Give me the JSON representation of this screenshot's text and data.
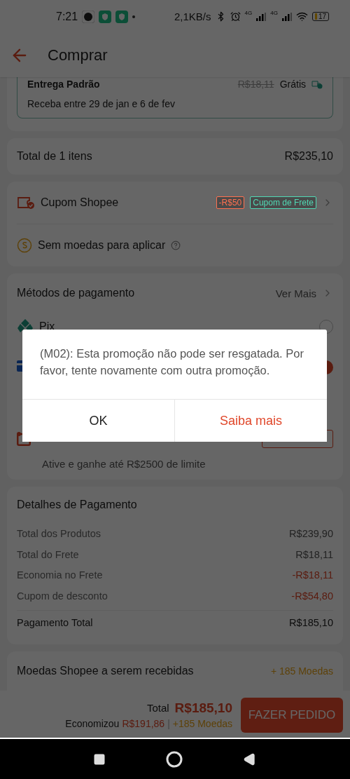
{
  "status_bar": {
    "time": "7:21",
    "speed": "2,1KB/s",
    "network_labels": [
      "4G",
      "4G"
    ],
    "battery": "17"
  },
  "header": {
    "title": "Comprar"
  },
  "delivery": {
    "name": "Entrega Padrão",
    "old_price": "R$18,11",
    "price": "Grátis",
    "window": "Receba entre 29 de jan e 6 de fev"
  },
  "items_total": {
    "label": "Total de 1 itens",
    "value": "R$235,10"
  },
  "vouchers": {
    "coupon_label": "Cupom Shopee",
    "tags": [
      {
        "text": "-R$50",
        "color": "#ff7050"
      },
      {
        "text": "Cupom de Frete",
        "color": "#50d8b4"
      }
    ],
    "coins_label": "Sem moedas para aplicar"
  },
  "payment_methods": {
    "title": "Métodos de pagamento",
    "more": "Ver Mais",
    "items": [
      {
        "kind": "pix",
        "label": "Pix",
        "selected": false
      },
      {
        "kind": "card",
        "selected": true
      },
      {
        "kind": "credit_line",
        "note": "Ative e ganhe até R$2500 de limite"
      }
    ]
  },
  "payment_details": {
    "title": "Detalhes de Pagamento",
    "rows": [
      {
        "label": "Total dos Produtos",
        "value": "R$239,90",
        "discount": false
      },
      {
        "label": "Total do Frete",
        "value": "R$18,11",
        "discount": false
      },
      {
        "label": "Economia no Frete",
        "value": "-R$18,11",
        "discount": true
      },
      {
        "label": "Cupom de desconto",
        "value": "-R$54,80",
        "discount": true
      }
    ],
    "total_label": "Pagamento Total",
    "total_value": "R$185,10"
  },
  "coins": {
    "label": "Moedas Shopee a serem recebidas",
    "value": "+ 185 Moedas"
  },
  "checkout": {
    "total_label": "Total",
    "total_value": "R$185,10",
    "saved_label": "Economizou",
    "saved_value": "R$191,86",
    "separator": "|",
    "coins": "+185 Moedas",
    "button": "FAZER PEDIDO"
  },
  "dialog": {
    "message": "(M02): Esta promoção não pode ser resgatada. Por favor, tente novamente com outra promoção.",
    "buttons": [
      {
        "label": "OK",
        "primary": false
      },
      {
        "label": "Saiba mais",
        "primary": true
      }
    ]
  }
}
